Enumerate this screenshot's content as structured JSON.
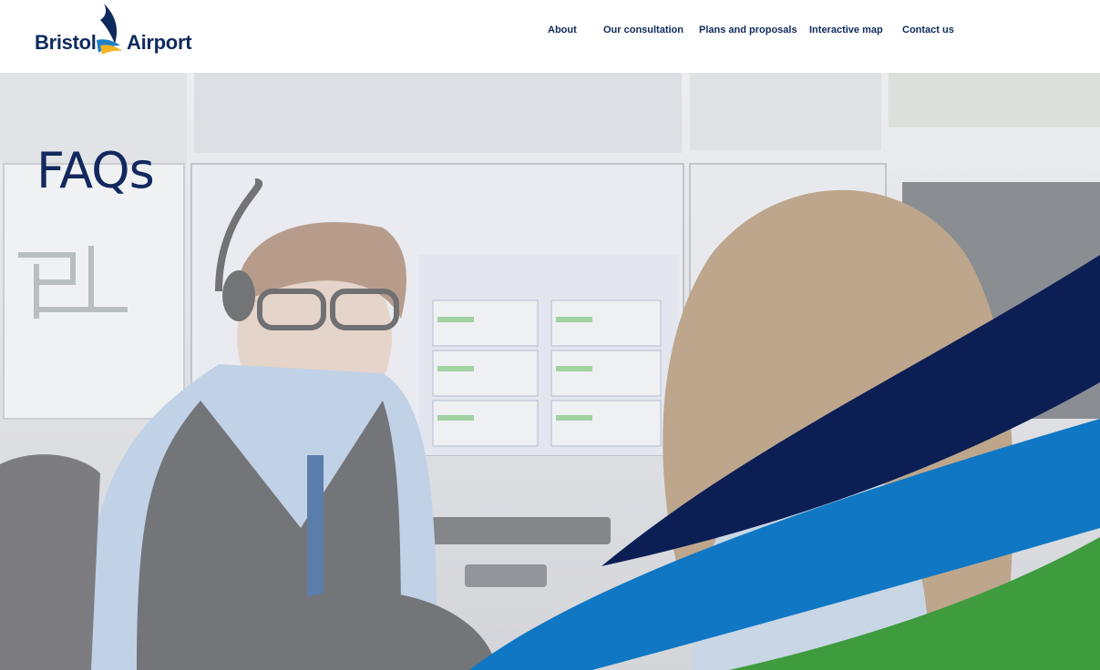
{
  "brand": {
    "name_left": "Bristol",
    "name_right": "Airport",
    "logo_icon": "tailfin-logo-icon"
  },
  "nav": {
    "items": [
      {
        "label": "About"
      },
      {
        "label": "Our consultation"
      },
      {
        "label": "Plans and proposals"
      },
      {
        "label": "Interactive map"
      },
      {
        "label": "Contact us"
      }
    ]
  },
  "hero": {
    "title": "FAQs",
    "image": "airport-control-room-staff-photo"
  },
  "colors": {
    "navy": "#0f2a5c",
    "wave_navy": "#0c1f55",
    "wave_blue": "#0f77c4",
    "wave_green": "#3e9b3e"
  }
}
